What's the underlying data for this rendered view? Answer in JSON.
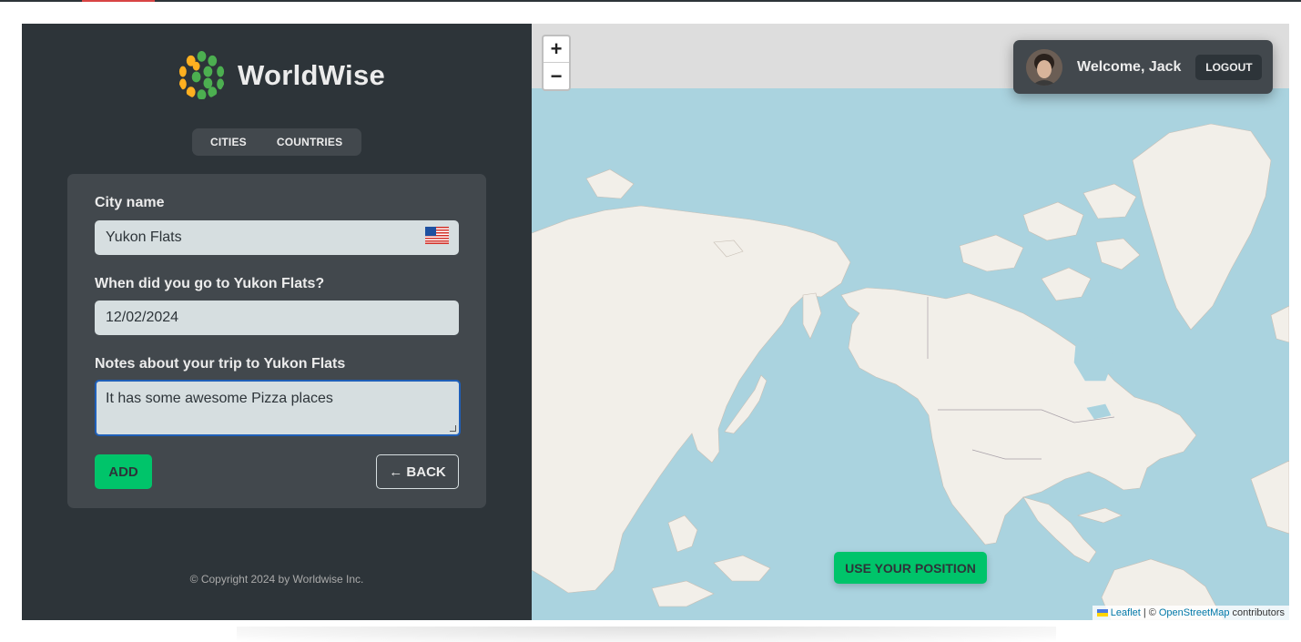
{
  "app": {
    "name": "WorldWise"
  },
  "tabs": [
    {
      "label": "Cities"
    },
    {
      "label": "Countries"
    }
  ],
  "form": {
    "city_label": "City name",
    "city_value": "Yukon Flats",
    "city_flag": "🇺🇸",
    "date_label": "When did you go to Yukon Flats?",
    "date_value": "12/02/2024",
    "notes_label": "Notes about your trip to Yukon Flats",
    "notes_value": "It has some awesome Pizza places",
    "add_label": "ADD",
    "back_label": "← BACK"
  },
  "footer": {
    "copyright": "© Copyright 2024 by Worldwise Inc."
  },
  "map": {
    "zoom_in": "+",
    "zoom_out": "−",
    "use_position_label": "USE YOUR POSITION",
    "attribution": {
      "leaflet": "Leaflet",
      "separator": "| ©",
      "osm": "OpenStreetMap",
      "contributors": "contributors"
    }
  },
  "user": {
    "welcome": "Welcome, Jack",
    "logout_label": "LOGOUT"
  },
  "colors": {
    "sidebar": "#2d3439",
    "card": "#42484d",
    "accent": "#00c46a",
    "water": "#aad3df",
    "land": "#f2efe9"
  }
}
